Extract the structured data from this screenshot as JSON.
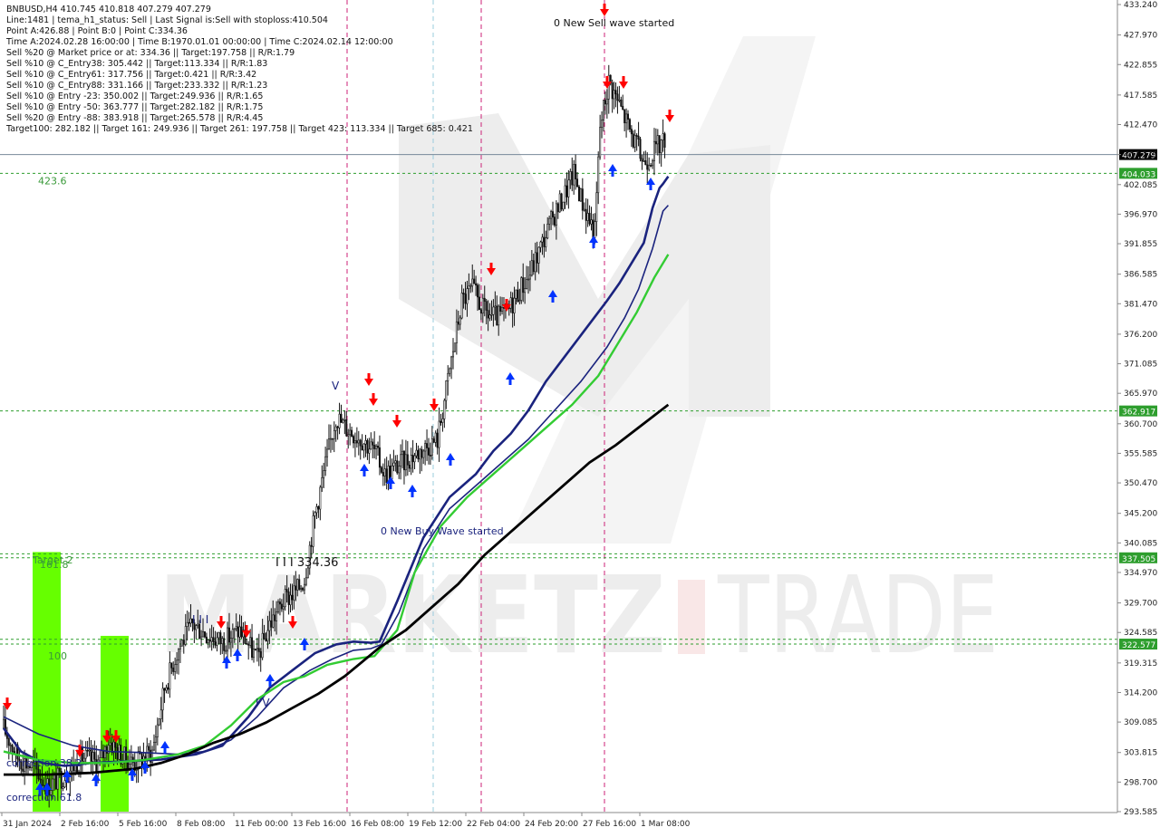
{
  "header": {
    "lines": [
      "BNBUSD,H4  410.745 410.818 407.279 407.279",
      "Line:1481 | tema_h1_status: Sell | Last Signal is:Sell with stoploss:410.504",
      "Point A:426.88 | Point B:0 | Point C:334.36",
      "Time A:2024.02.28 16:00:00 | Time B:1970.01.01 00:00:00 | Time C:2024.02.14 12:00:00",
      "Sell %20 @ Market price or at: 334.36 || Target:197.758 || R/R:1.79",
      "Sell %10 @ C_Entry38: 305.442 || Target:113.334 || R/R:1.83",
      "Sell %10 @ C_Entry61: 317.756 || Target:0.421 || R/R:3.42",
      "Sell %10 @ C_Entry88: 331.166 || Target:233.332 || R/R:1.23",
      "Sell %10 @ Entry -23: 350.002 || Target:249.936 || R/R:1.65",
      "Sell %10 @ Entry -50: 363.777 || Target:282.182 || R/R:1.75",
      "Sell %20 @ Entry -88: 383.918 || Target:265.578 || R/R:4.45",
      "Target100: 282.182 || Target 161: 249.936 || Target 261: 197.758 || Target 423: 113.334 || Target 685: 0.421"
    ]
  },
  "chart_data": {
    "type": "candlestick",
    "symbol": "BNBUSD",
    "timeframe": "H4",
    "ylim": [
      293.585,
      433.24
    ],
    "y_ticks": [
      "433.240",
      "427.970",
      "422.855",
      "417.585",
      "412.470",
      "407.279",
      "402.085",
      "396.970",
      "391.855",
      "386.585",
      "381.470",
      "376.200",
      "371.085",
      "365.970",
      "360.700",
      "355.585",
      "350.470",
      "345.200",
      "340.085",
      "334.970",
      "329.700",
      "324.585",
      "319.315",
      "314.200",
      "309.085",
      "303.815",
      "298.700",
      "293.585"
    ],
    "x_ticks": [
      "31 Jan 2024",
      "2 Feb 16:00",
      "5 Feb 16:00",
      "8 Feb 08:00",
      "11 Feb 00:00",
      "13 Feb 16:00",
      "16 Feb 08:00",
      "19 Feb 12:00",
      "22 Feb 04:00",
      "24 Feb 20:00",
      "27 Feb 16:00",
      "1 Mar 08:00"
    ],
    "current_price": {
      "value": 407.279,
      "label": "407.279"
    },
    "levels": [
      {
        "value": 404.033,
        "label": "404.033",
        "color": "#2e9e2e",
        "left_label": "423.6"
      },
      {
        "value": 362.917,
        "label": "362.917",
        "color": "#2e9e2e"
      },
      {
        "value": 338.2,
        "label": "",
        "color": "#2e9e2e"
      },
      {
        "value": 337.505,
        "label": "337.505",
        "color": "#2e9e2e"
      },
      {
        "value": 323.4,
        "label": "",
        "color": "#2e9e2e"
      },
      {
        "value": 322.577,
        "label": "322.577",
        "color": "#2e9e2e"
      }
    ],
    "vertical_markers": [
      {
        "x": "14 Feb 16:00",
        "color": "#cc2277"
      },
      {
        "x": "19 Feb 20:00",
        "color": "#99ccdd"
      },
      {
        "x": "21 Feb 20:00",
        "color": "#cc2277"
      },
      {
        "x": "28 Feb 04:00",
        "color": "#cc2277"
      }
    ],
    "annotations": [
      {
        "text": "0 New Sell wave started"
      },
      {
        "text": "0 New Buy Wave started"
      },
      {
        "text": "V"
      },
      {
        "text": "I I I"
      },
      {
        "text": "I I I 334.36"
      },
      {
        "text": "I V"
      },
      {
        "text": "Target 2"
      },
      {
        "text": "161.8"
      },
      {
        "text": "100"
      },
      {
        "text": "correction 38.2"
      },
      {
        "text": "correction 61.8"
      }
    ],
    "colors": {
      "candle": "#111111",
      "ema_fast": "#1a237e",
      "ema_mid": "#1a237e",
      "ema_green": "#33cc33",
      "ema_slow": "#000000",
      "sell_arrow": "#ff0000",
      "buy_arrow": "#0033ff",
      "zone": "#66ff00"
    },
    "series": [
      {
        "points": [
          [
            0,
            308
          ],
          [
            10,
            304
          ],
          [
            22,
            302
          ],
          [
            35,
            301.5
          ],
          [
            50,
            302
          ],
          [
            70,
            302.3
          ],
          [
            90,
            302.6
          ],
          [
            110,
            303.5
          ],
          [
            125,
            305
          ],
          [
            140,
            310
          ],
          [
            152,
            315
          ],
          [
            165,
            318
          ],
          [
            178,
            321
          ],
          [
            190,
            322.5
          ],
          [
            200,
            323
          ],
          [
            210,
            322.8
          ],
          [
            215,
            323
          ],
          [
            225,
            330
          ],
          [
            240,
            341
          ],
          [
            255,
            348
          ],
          [
            270,
            352
          ],
          [
            280,
            356
          ],
          [
            290,
            359
          ],
          [
            300,
            363
          ],
          [
            310,
            368
          ],
          [
            320,
            372
          ],
          [
            330,
            376
          ],
          [
            340,
            380
          ],
          [
            345,
            382
          ],
          [
            352,
            385
          ],
          [
            360,
            389
          ],
          [
            366,
            392
          ],
          [
            371,
            398
          ],
          [
            375,
            401.5
          ],
          [
            377,
            402.2
          ],
          [
            380,
            403.5
          ]
        ]
      },
      {
        "points": [
          [
            0,
            310
          ],
          [
            20,
            307
          ],
          [
            40,
            305
          ],
          [
            60,
            304
          ],
          [
            80,
            303.8
          ],
          [
            100,
            303.5
          ],
          [
            115,
            304
          ],
          [
            130,
            306
          ],
          [
            145,
            310
          ],
          [
            160,
            315
          ],
          [
            175,
            318
          ],
          [
            188,
            320
          ],
          [
            200,
            321.5
          ],
          [
            210,
            321.8
          ],
          [
            216,
            322.5
          ],
          [
            226,
            328
          ],
          [
            240,
            339
          ],
          [
            255,
            346
          ],
          [
            270,
            350
          ],
          [
            285,
            354
          ],
          [
            300,
            358
          ],
          [
            315,
            363
          ],
          [
            330,
            368
          ],
          [
            345,
            374
          ],
          [
            355,
            379
          ],
          [
            363,
            384
          ],
          [
            371,
            391
          ],
          [
            377,
            397.5
          ],
          [
            380,
            398.5
          ]
        ]
      },
      {
        "points": [
          [
            0,
            304
          ],
          [
            20,
            302.5
          ],
          [
            40,
            302
          ],
          [
            60,
            302
          ],
          [
            80,
            302.5
          ],
          [
            100,
            303.5
          ],
          [
            115,
            305
          ],
          [
            130,
            308.5
          ],
          [
            145,
            313
          ],
          [
            160,
            316
          ],
          [
            172,
            317
          ],
          [
            185,
            319
          ],
          [
            200,
            320
          ],
          [
            212,
            320.5
          ],
          [
            225,
            325
          ],
          [
            235,
            335
          ],
          [
            250,
            343
          ],
          [
            265,
            348
          ],
          [
            280,
            352
          ],
          [
            295,
            356
          ],
          [
            310,
            360
          ],
          [
            325,
            364
          ],
          [
            340,
            369
          ],
          [
            352,
            375
          ],
          [
            362,
            380
          ],
          [
            372,
            386
          ],
          [
            380,
            390
          ]
        ]
      },
      {
        "points": [
          [
            0,
            300
          ],
          [
            25,
            300
          ],
          [
            50,
            300.3
          ],
          [
            75,
            301
          ],
          [
            90,
            302
          ],
          [
            105,
            303.5
          ],
          [
            120,
            305.5
          ],
          [
            135,
            307
          ],
          [
            150,
            309
          ],
          [
            165,
            311.5
          ],
          [
            180,
            314
          ],
          [
            195,
            317
          ],
          [
            205,
            319.5
          ],
          [
            215,
            322
          ],
          [
            230,
            325
          ],
          [
            245,
            329
          ],
          [
            260,
            333
          ],
          [
            275,
            338
          ],
          [
            290,
            342
          ],
          [
            305,
            346
          ],
          [
            320,
            350
          ],
          [
            335,
            354
          ],
          [
            350,
            357
          ],
          [
            365,
            360.5
          ],
          [
            380,
            364
          ]
        ]
      }
    ]
  }
}
